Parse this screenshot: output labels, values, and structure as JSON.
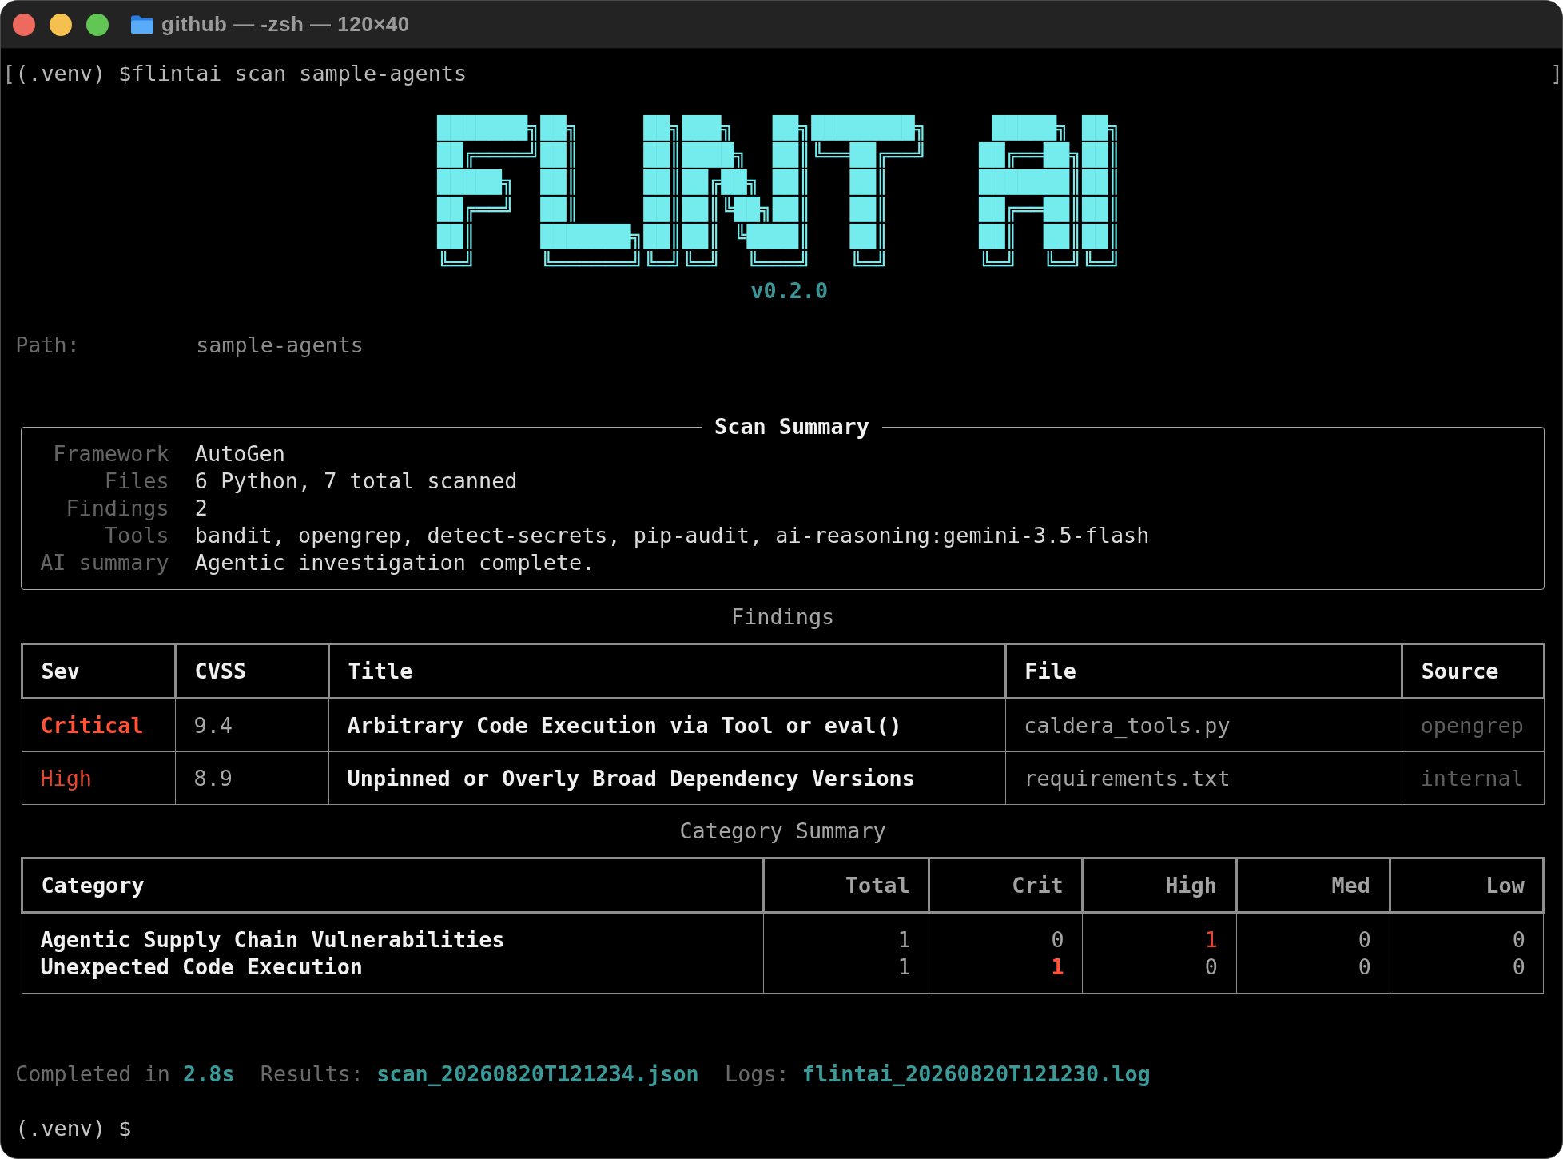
{
  "window": {
    "title": "github — -zsh — 120×40"
  },
  "terminal": {
    "command_line": {
      "mark_open": "[",
      "command": "(.venv) $flintai scan sample-agents",
      "mark_close": "]"
    },
    "logo_lines": [
      "███████╗██╗     ██╗███╗   ██╗████████╗     █████╗ ██╗",
      "██╔════╝██║     ██║████╗  ██║╚══██╔══╝    ██╔══██╗██║",
      "█████╗  ██║     ██║██╔██╗ ██║   ██║       ███████║██║",
      "██╔══╝  ██║     ██║██║╚██╗██║   ██║       ██╔══██║██║",
      "██║     ███████╗██║██║ ╚████║   ██║       ██║  ██║██║",
      "╚═╝     ╚══════╝╚═╝╚═╝  ╚═══╝   ╚═╝       ╚═╝  ╚═╝╚═╝"
    ],
    "version": "v0.2.0",
    "path": {
      "label": "Path:",
      "value": "sample-agents"
    },
    "scan_summary": {
      "title": "Scan Summary",
      "rows": [
        {
          "label": "Framework",
          "value": "AutoGen"
        },
        {
          "label": "Files",
          "value": "6 Python, 7 total scanned"
        },
        {
          "label": "Findings",
          "value": "2"
        },
        {
          "label": "Tools",
          "value": "bandit, opengrep, detect-secrets, pip-audit, ai-reasoning:gemini-3.5-flash"
        },
        {
          "label": "AI summary",
          "value": "Agentic investigation complete."
        }
      ]
    },
    "findings": {
      "caption": "Findings",
      "columns": [
        "Sev",
        "CVSS",
        "Title",
        "File",
        "Source"
      ],
      "rows": [
        {
          "kind": "critical",
          "cells": [
            "Critical",
            "9.4",
            "Arbitrary Code Execution via Tool or eval()",
            "caldera_tools.py",
            "opengrep"
          ]
        },
        {
          "kind": "high",
          "cells": [
            "High",
            "8.9",
            "Unpinned or Overly Broad Dependency Versions",
            "requirements.txt",
            "internal"
          ]
        }
      ]
    },
    "category_summary": {
      "caption": "Category Summary",
      "columns": [
        "Category",
        "Total",
        "Crit",
        "High",
        "Med",
        "Low"
      ],
      "rows": [
        {
          "category": "Agentic Supply Chain Vulnerabilities",
          "counts": [
            {
              "kind": "plain",
              "value": "1"
            },
            {
              "kind": "plain",
              "value": "0"
            },
            {
              "kind": "high",
              "value": "1"
            },
            {
              "kind": "plain",
              "value": "0"
            },
            {
              "kind": "plain",
              "value": "0"
            }
          ]
        },
        {
          "category": "Unexpected Code Execution",
          "counts": [
            {
              "kind": "plain",
              "value": "1"
            },
            {
              "kind": "critical",
              "value": "1"
            },
            {
              "kind": "plain",
              "value": "0"
            },
            {
              "kind": "plain",
              "value": "0"
            },
            {
              "kind": "plain",
              "value": "0"
            }
          ]
        }
      ]
    },
    "footer": [
      {
        "kind": "label",
        "text": "Completed in"
      },
      {
        "kind": "value",
        "text": "2.8s"
      },
      {
        "kind": "label",
        "text": "Results:"
      },
      {
        "kind": "value",
        "text": "scan_20260820T121234.json"
      },
      {
        "kind": "label",
        "text": "Logs:"
      },
      {
        "kind": "value",
        "text": "flintai_20260820T121230.log"
      }
    ],
    "prompt": "(.venv) $"
  }
}
